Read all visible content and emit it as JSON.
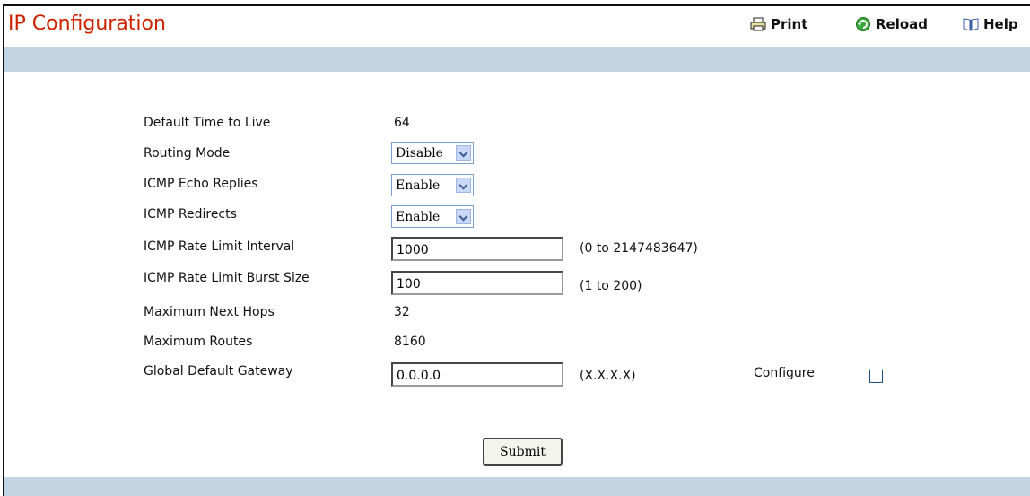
{
  "header": {
    "title": "IP Configuration",
    "print_label": "Print",
    "reload_label": "Reload",
    "help_label": "Help"
  },
  "form": {
    "default_ttl": {
      "label": "Default Time to Live",
      "value": "64"
    },
    "routing_mode": {
      "label": "Routing Mode",
      "value": "Disable"
    },
    "icmp_echo": {
      "label": "ICMP Echo Replies",
      "value": "Enable"
    },
    "icmp_redirects": {
      "label": "ICMP Redirects",
      "value": "Enable"
    },
    "icmp_rate_interval": {
      "label": "ICMP Rate Limit Interval",
      "value": "1000",
      "hint": "(0 to 2147483647)"
    },
    "icmp_rate_burst": {
      "label": "ICMP Rate Limit Burst Size",
      "value": "100",
      "hint": "(1 to 200)"
    },
    "max_next_hops": {
      "label": "Maximum Next Hops",
      "value": "32"
    },
    "max_routes": {
      "label": "Maximum Routes",
      "value": "8160"
    },
    "global_gateway": {
      "label": "Global Default Gateway",
      "value": "0.0.0.0",
      "hint": "(X.X.X.X)",
      "configure_label": "Configure",
      "configure_checked": false
    }
  },
  "submit_label": "Submit",
  "colors": {
    "title": "#cc2200",
    "band": "#c2d4e2"
  },
  "icons": {
    "print": "printer-icon",
    "reload": "reload-icon",
    "help": "book-icon"
  }
}
